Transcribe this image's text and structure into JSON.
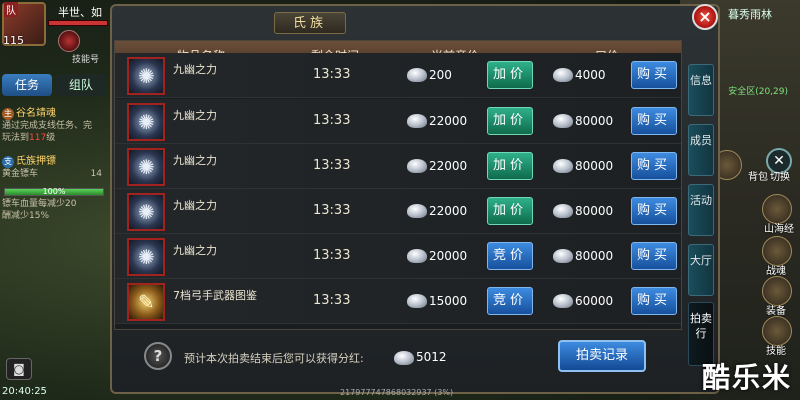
{
  "player": {
    "team_tag": "队",
    "level": "115",
    "name": "半世、如",
    "skill_label": "技能号"
  },
  "left_tabs": {
    "task": "任务",
    "team": "组队"
  },
  "quests": [
    {
      "badge": "主",
      "title": "谷名靖魂",
      "line1": "通过完成支线任务、完",
      "line2_prefix": "玩法到",
      "line2_red": "117",
      "line2_suffix": "级"
    },
    {
      "badge": "支",
      "title": "氏族押镖",
      "line1": "黄金镖车",
      "line1_suffix": "14",
      "progress_label": "100%",
      "progress": 1.0,
      "line2": "镖车血量每减少20",
      "line3": "酬减少15%"
    }
  ],
  "clock": "20:40:25",
  "map": {
    "name": "暮秀雨林",
    "safe_zone": "安全区(20,29)"
  },
  "side_buttons": [
    "背包",
    "切换",
    "山海经",
    "战魂",
    "装备",
    "技能"
  ],
  "panel": {
    "title": "氏族",
    "columns": [
      "物品名称",
      "剩余时间",
      "当前竞价",
      "一口价"
    ],
    "rows": [
      {
        "name": "九幽之力",
        "time": "13:33",
        "bid": "200",
        "bid_btn": "加价",
        "bid_style": "green",
        "buyout": "4000",
        "buy_btn": "购买",
        "icon": "soul-icon"
      },
      {
        "name": "九幽之力",
        "time": "13:33",
        "bid": "22000",
        "bid_btn": "加价",
        "bid_style": "green",
        "buyout": "80000",
        "buy_btn": "购买",
        "icon": "soul-icon"
      },
      {
        "name": "九幽之力",
        "time": "13:33",
        "bid": "22000",
        "bid_btn": "加价",
        "bid_style": "green",
        "buyout": "80000",
        "buy_btn": "购买",
        "icon": "soul-icon"
      },
      {
        "name": "九幽之力",
        "time": "13:33",
        "bid": "22000",
        "bid_btn": "加价",
        "bid_style": "green",
        "buyout": "80000",
        "buy_btn": "购买",
        "icon": "soul-icon"
      },
      {
        "name": "九幽之力",
        "time": "13:33",
        "bid": "20000",
        "bid_btn": "竞价",
        "bid_style": "blue",
        "buyout": "80000",
        "buy_btn": "购买",
        "icon": "soul-icon"
      },
      {
        "name": "7档弓手武器图鉴",
        "time": "13:33",
        "bid": "15000",
        "bid_btn": "竞价",
        "bid_style": "blue",
        "buyout": "60000",
        "buy_btn": "购买",
        "icon": "scroll-icon"
      }
    ],
    "side_tabs": [
      "信息",
      "成员",
      "活动",
      "大厅",
      "拍卖行"
    ],
    "footer_note": "预计本次拍卖结束后您可以获得分红:",
    "footer_value": "5012",
    "record_button": "拍卖记录",
    "help_symbol": "?"
  },
  "bottom_text": "217977747868032937 (3%)",
  "watermark": "酷乐米",
  "colors": {
    "bid_green": "#1f8f6a",
    "buy_blue": "#2a6fc4",
    "header_brown": "#5a4030",
    "accent_gold": "#f0dca0"
  }
}
